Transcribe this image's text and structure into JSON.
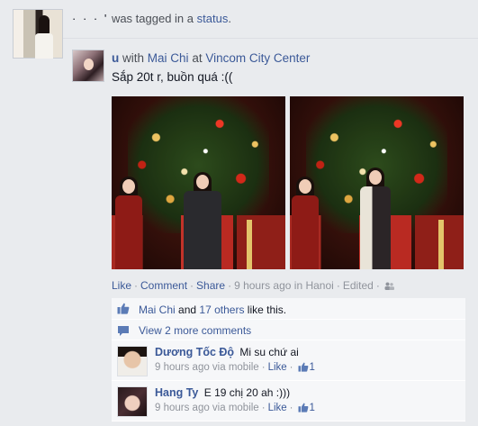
{
  "story": {
    "actor": "· · · '",
    "tagged_text": "was tagged in a",
    "status_link": "status",
    "period": "."
  },
  "post": {
    "author": "u",
    "with_text": "with",
    "with_person": "Mai Chi",
    "at_text": "at",
    "location": "Vincom City Center",
    "message": "Sắp 20t r, buồn quá :(("
  },
  "actions": {
    "like": "Like",
    "comment": "Comment",
    "share": "Share",
    "time": "9 hours ago in",
    "place": "Hanoi",
    "edited": "Edited",
    "separator": "·"
  },
  "ufi": {
    "likes_name": "Mai Chi",
    "likes_and": "and",
    "likes_others": "17 others",
    "likes_suffix": "like this.",
    "view_more": "View 2 more comments",
    "comments": [
      {
        "author": "Dương Tốc Độ",
        "text": "Mi su chứ ai",
        "time": "9 hours ago via mobile",
        "like": "Like",
        "like_count": "1"
      },
      {
        "author": "Hang Ty",
        "text": "E 19 chị 20 ah :)))",
        "time": "9 hours ago via mobile",
        "like": "Like",
        "like_count": "1"
      }
    ]
  },
  "icons": {
    "friends": "friends-icon",
    "thumb": "thumbs-up-icon",
    "comment": "comment-bubble-icon"
  },
  "colors": {
    "link": "#3b5998",
    "meta": "#90949c",
    "background": "#e9ebee",
    "ufi_background": "#f6f7f9"
  }
}
